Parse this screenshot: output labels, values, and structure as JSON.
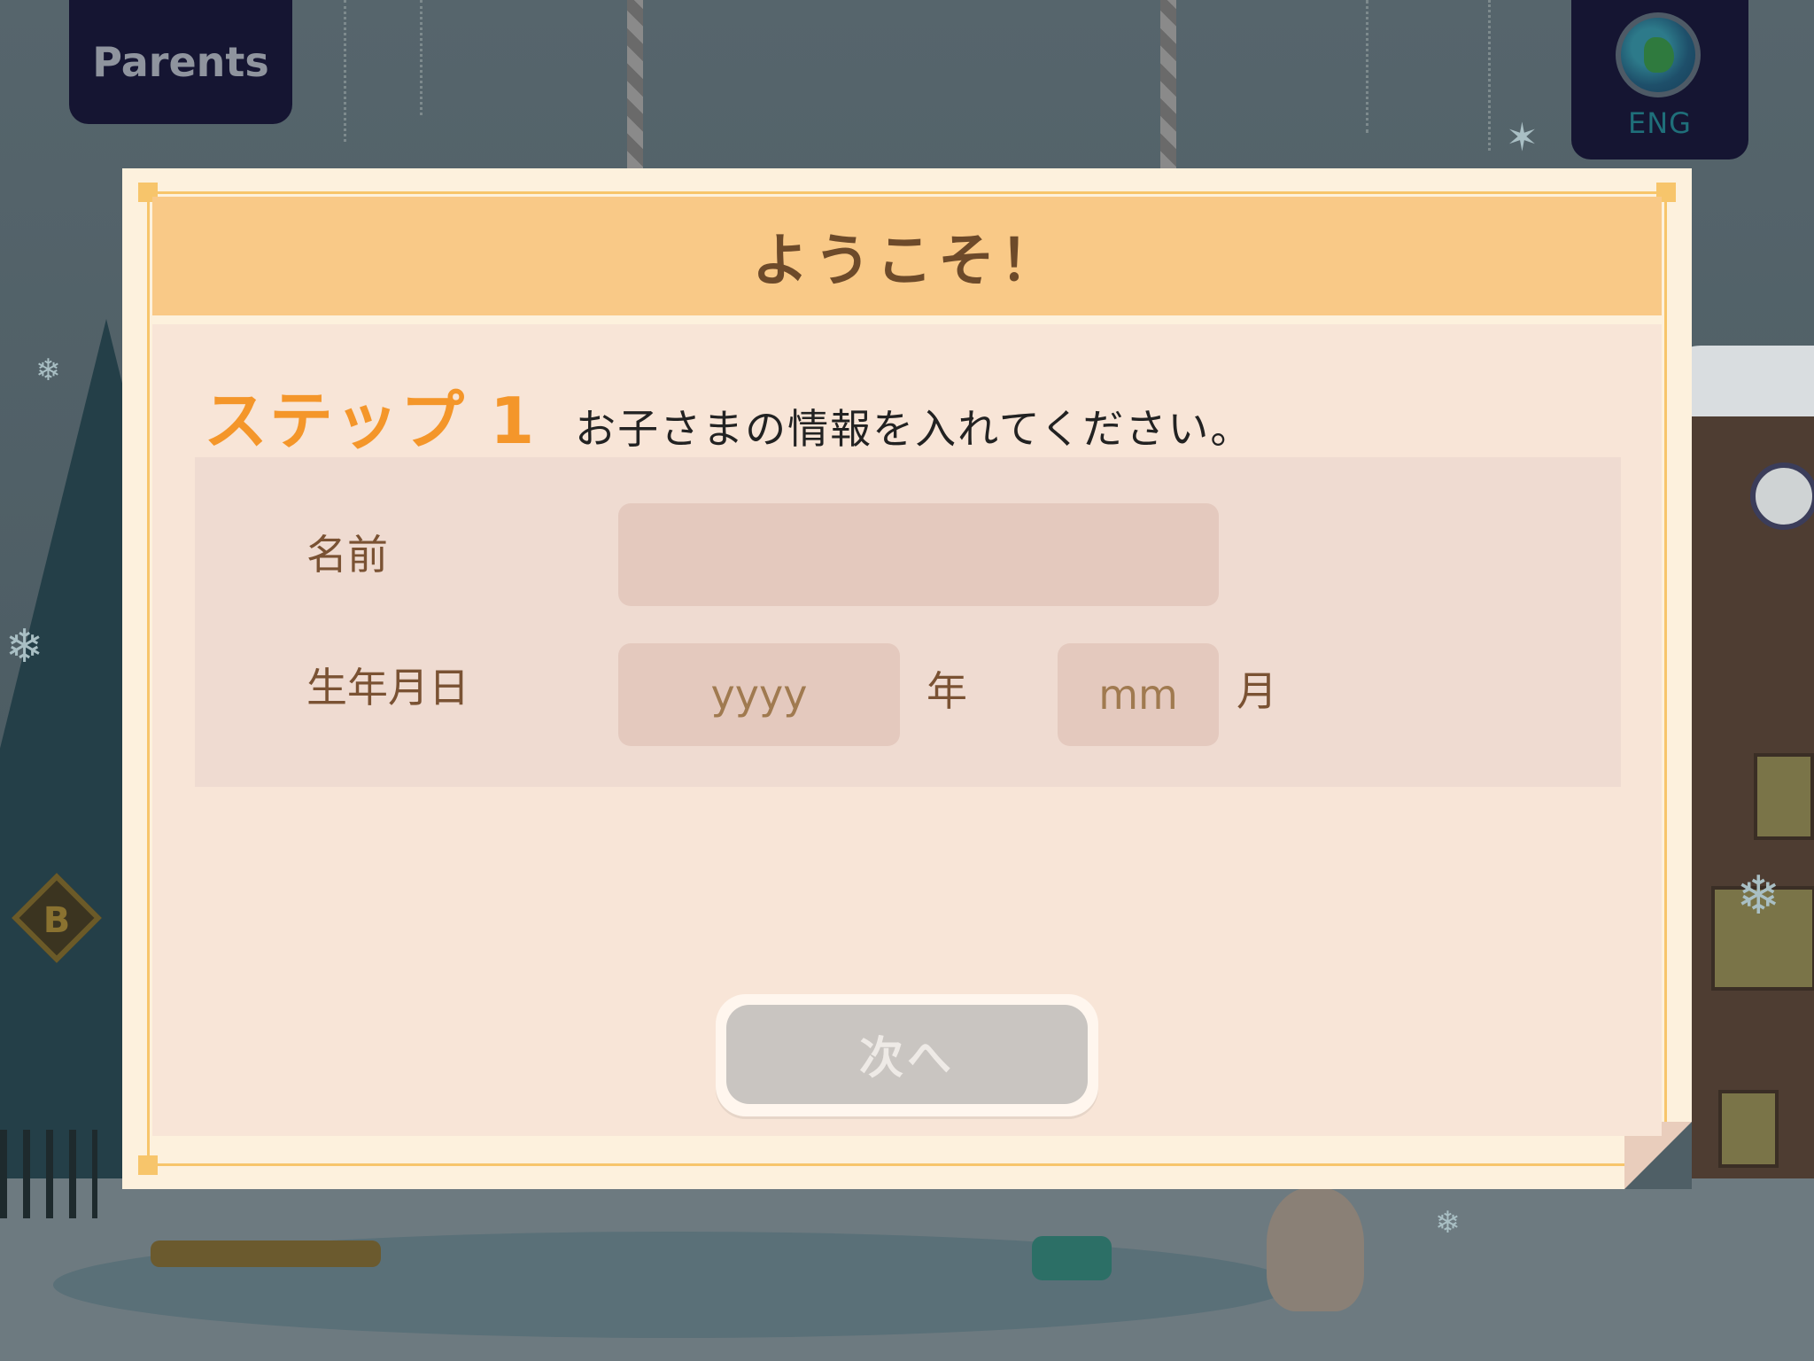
{
  "top_bar": {
    "parents_label": "Parents",
    "language_label": "ENG",
    "language_icon": "globe-icon"
  },
  "dialog": {
    "title": "ようこそ！",
    "step_label": "ステップ 1",
    "step_instruction": "お子さまの情報を入れてください。",
    "name_field": {
      "label": "名前",
      "value": "",
      "placeholder": ""
    },
    "birthdate_field": {
      "label": "生年月日",
      "year_placeholder": "yyyy",
      "year_unit": "年",
      "month_placeholder": "mm",
      "month_unit": "月"
    },
    "next_button_label": "次へ"
  },
  "colors": {
    "accent_orange": "#f4962a",
    "header_bg": "#f9c987",
    "title_text": "#6d4a2a",
    "disabled_button": "#c9c5c1"
  }
}
